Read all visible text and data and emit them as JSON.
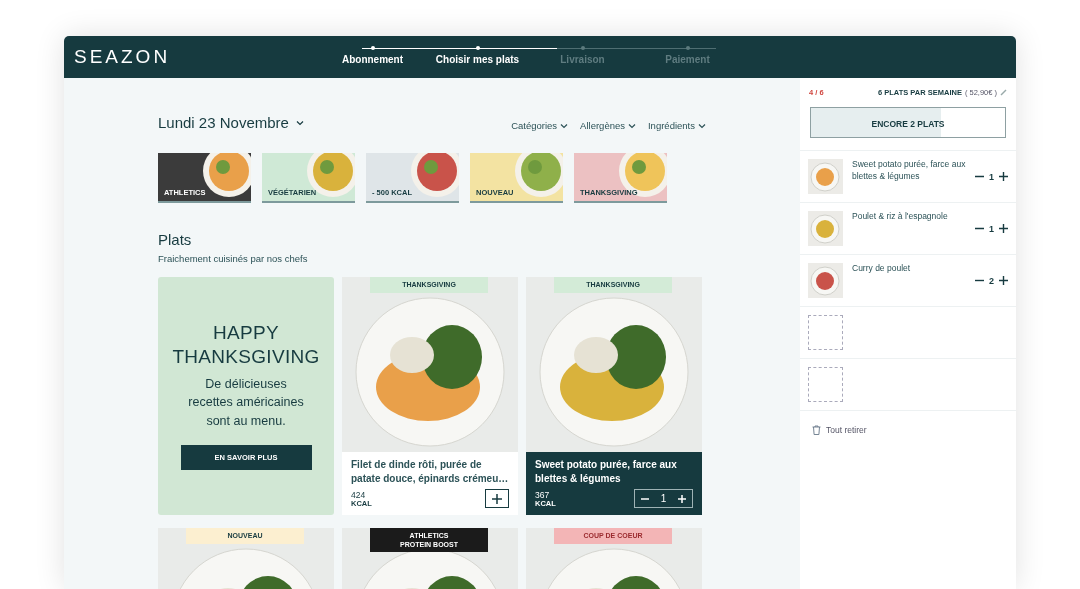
{
  "header": {
    "logo": "SEAZON",
    "progress": {
      "level": 0.55
    },
    "steps": [
      {
        "label": "Abonnement",
        "done": true
      },
      {
        "label": "Choisir mes plats",
        "done": true
      },
      {
        "label": "Livraison",
        "done": false
      },
      {
        "label": "Paiement",
        "done": false
      }
    ]
  },
  "date": "Lundi 23 Novembre",
  "filters": [
    "Catégories",
    "Allergènes",
    "Ingrédients"
  ],
  "categories": [
    {
      "label": "ATHLETICS",
      "color": "#3b3b3b",
      "kind": "dark"
    },
    {
      "label": "VÉGÉTARIEN",
      "color": "#cfe9d6",
      "kind": "light"
    },
    {
      "label": "- 500 KCAL",
      "color": "#dfe5e8",
      "kind": "light"
    },
    {
      "label": "NOUVEAU",
      "color": "#f3e3a2",
      "kind": "light"
    },
    {
      "label": "THANKSGIVING",
      "color": "#ecc1c2",
      "kind": "light"
    }
  ],
  "section": {
    "title": "Plats",
    "subtitle": "Fraichement cuisinés par nos chefs"
  },
  "promo": {
    "title": "HAPPY THANKSGIVING",
    "text": "De délicieuses recettes américaines sont au menu.",
    "button": "EN SAVOIR PLUS"
  },
  "dishes": [
    {
      "tag": "THANKSGIVING",
      "color": "#d3ebd7",
      "kind": "light",
      "name": "Filet de dinde rôti, purée de patate douce, épinards crémeu…",
      "kcal": "424",
      "unit": "KCAL",
      "selected": false
    },
    {
      "tag": "THANKSGIVING",
      "color": "#d3ebd7",
      "kind": "light",
      "name": "Sweet potato purée, farce aux blettes & légumes",
      "kcal": "367",
      "unit": "KCAL",
      "selected": true,
      "quantity": "1"
    },
    {
      "tag": "NOUVEAU",
      "color": "#fcefd0",
      "kind": "light"
    },
    {
      "tag": "ATHLETICS\nPROTEIN BOOST",
      "color": "#1b1b1b",
      "kind": "dark"
    },
    {
      "tag": "COUP DE COEUR",
      "color": "#f3b5b6",
      "kind": "red"
    }
  ],
  "cart": {
    "count": "4 / 6",
    "plan": "6 PLATS PAR SEMAINE",
    "price": "( 52,90€ )",
    "button": "ENCORE 2 PLATS",
    "level": 0.67,
    "items": [
      {
        "kind": "dish",
        "name": "Sweet potato purée, farce aux blettes & légumes",
        "quantity": "1"
      },
      {
        "kind": "dish",
        "name": "Poulet & riz à l'espagnole",
        "quantity": "1"
      },
      {
        "kind": "dish",
        "name": "Curry de poulet",
        "quantity": "2"
      },
      {
        "kind": "empty"
      },
      {
        "kind": "empty"
      }
    ],
    "clear": "Tout retirer"
  }
}
